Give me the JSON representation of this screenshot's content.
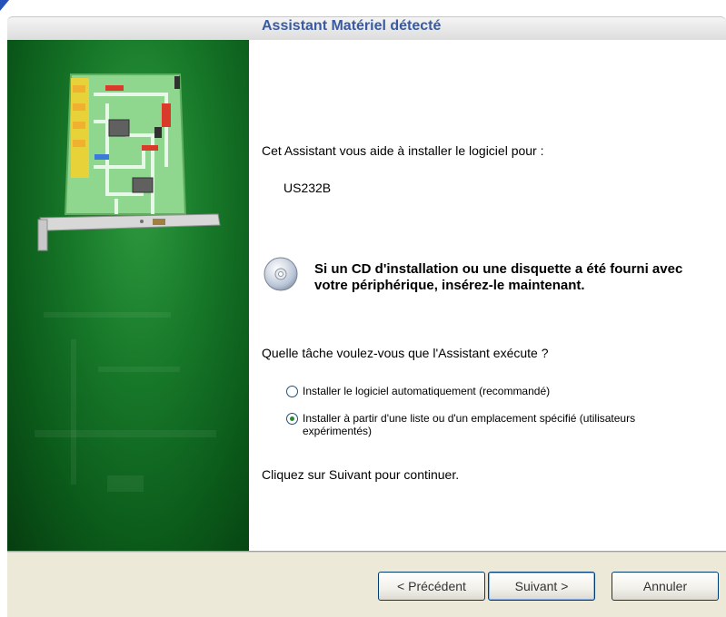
{
  "window": {
    "title": "Assistant Matériel détecté"
  },
  "main": {
    "intro": "Cet Assistant vous aide à installer le logiciel pour :",
    "device_name": "US232B",
    "cd_note": "Si un CD d'installation ou une disquette a été fourni avec votre périphérique, insérez-le maintenant.",
    "question": "Quelle tâche voulez-vous que l'Assistant exécute ?",
    "options": [
      {
        "label": "Installer le logiciel automatiquement (recommandé)",
        "selected": false
      },
      {
        "label": "Installer à partir d'une liste ou d'un emplacement spécifié (utilisateurs expérimentés)",
        "selected": true
      }
    ],
    "continue_hint": "Cliquez sur Suivant pour continuer."
  },
  "footer": {
    "back_label": "< Précédent",
    "next_label": "Suivant >",
    "cancel_label": "Annuler"
  },
  "colors": {
    "title_text": "#3a5aa0",
    "side_panel": "#187a2a",
    "footer_bg": "#ece9d8"
  }
}
